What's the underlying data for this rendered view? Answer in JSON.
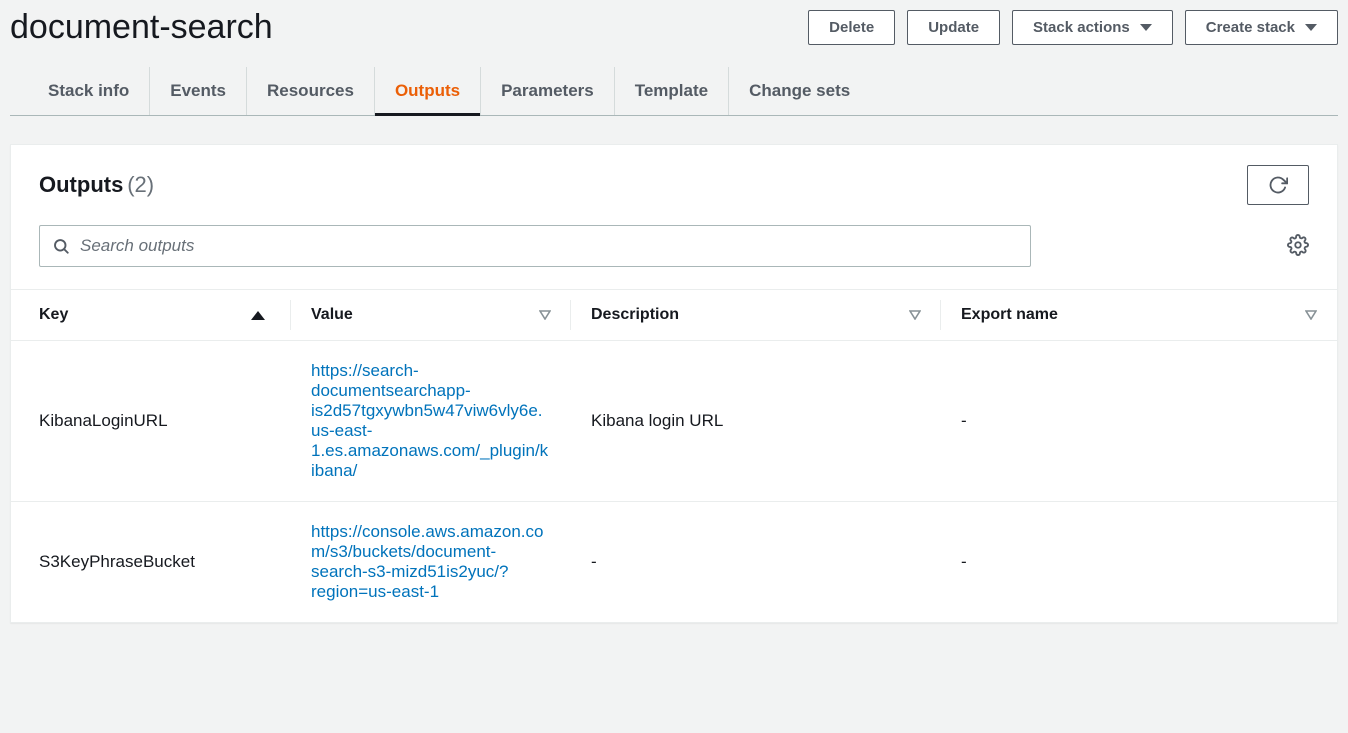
{
  "header": {
    "title": "document-search",
    "buttons": {
      "delete": "Delete",
      "update": "Update",
      "stack_actions": "Stack actions",
      "create_stack": "Create stack"
    }
  },
  "tabs": [
    {
      "id": "stack-info",
      "label": "Stack info",
      "active": false
    },
    {
      "id": "events",
      "label": "Events",
      "active": false
    },
    {
      "id": "resources",
      "label": "Resources",
      "active": false
    },
    {
      "id": "outputs",
      "label": "Outputs",
      "active": true
    },
    {
      "id": "parameters",
      "label": "Parameters",
      "active": false
    },
    {
      "id": "template",
      "label": "Template",
      "active": false
    },
    {
      "id": "change-sets",
      "label": "Change sets",
      "active": false
    }
  ],
  "panel": {
    "title": "Outputs",
    "count": "(2)",
    "search_placeholder": "Search outputs"
  },
  "columns": {
    "key": "Key",
    "value": "Value",
    "description": "Description",
    "export": "Export name"
  },
  "rows": [
    {
      "key": "KibanaLoginURL",
      "value": "https://search-documentsearchapp-is2d57tgxywbn5w47viw6vly6e.us-east-1.es.amazonaws.com/_plugin/kibana/",
      "description": "Kibana login URL",
      "export": "-"
    },
    {
      "key": "S3KeyPhraseBucket",
      "value": "https://console.aws.amazon.com/s3/buckets/document-search-s3-mizd51is2yuc/?region=us-east-1",
      "description": "-",
      "export": "-"
    }
  ]
}
